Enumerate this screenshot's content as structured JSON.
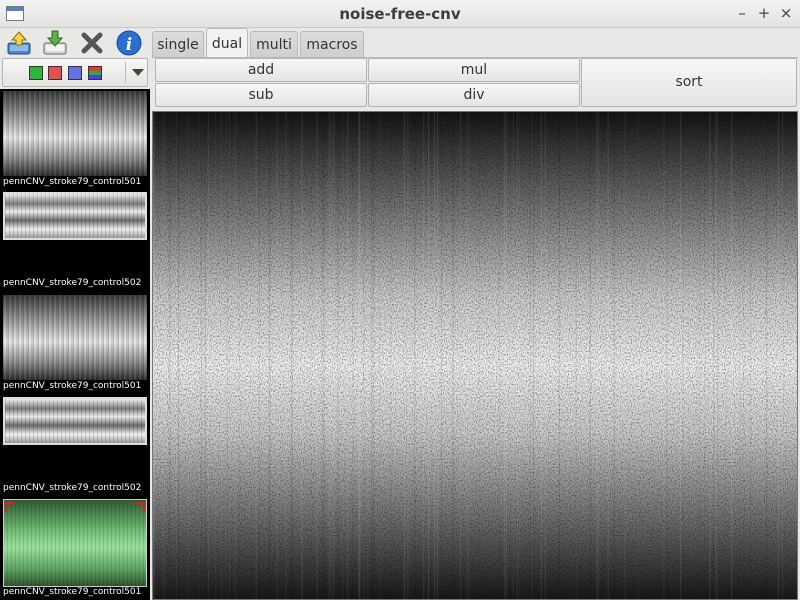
{
  "window": {
    "title": "noise-free-cnv",
    "controls": {
      "minimize": "–",
      "maximize": "+",
      "close": "×"
    }
  },
  "toolbar": [
    {
      "id": "upload",
      "icon": "upload-icon"
    },
    {
      "id": "download",
      "icon": "download-icon"
    },
    {
      "id": "close",
      "icon": "close-icon"
    },
    {
      "id": "info",
      "icon": "info-icon"
    }
  ],
  "tabs": [
    "single",
    "dual",
    "multi",
    "macros"
  ],
  "active_tab": "dual",
  "operations": {
    "add": "add",
    "mul": "mul",
    "sub": "sub",
    "div": "div",
    "sort": "sort"
  },
  "color_selector": {
    "swatches": [
      "green",
      "red",
      "blue",
      "multi"
    ],
    "colors": {
      "green": "#2fb53a",
      "red": "#e55050",
      "blue": "#6672e8"
    }
  },
  "thumbnails": [
    {
      "caption": "pennCNV_stroke79_control501",
      "style": "full"
    },
    {
      "caption": "pennCNV_stroke79_control502",
      "style": "band"
    },
    {
      "caption": "pennCNV_stroke79_control501",
      "style": "full"
    },
    {
      "caption": "pennCNV_stroke79_control502",
      "style": "band"
    },
    {
      "caption": "pennCNV_stroke79_control501",
      "style": "green",
      "selected": true
    }
  ],
  "viewer": {
    "description_icon": "noise-image"
  }
}
